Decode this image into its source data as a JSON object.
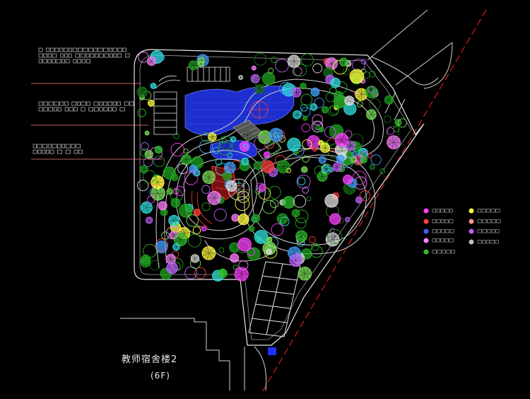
{
  "drawing": {
    "building_label": "教师宿舍楼2",
    "building_floors": "(6F)",
    "colors": {
      "background": "#000000",
      "boundary": "#e6e6e6",
      "property_line": "#ff2020",
      "tree_green": "#1fa21f",
      "tree_light": "#7ee35a",
      "water": "#1e2fcf",
      "path": "#cfcfcf",
      "pavilion": "#ff3b30",
      "leader": "#ff8080"
    },
    "legend": [
      {
        "color": "#ff40ff",
        "icon": "flower-shrub-icon"
      },
      {
        "color": "#ff4040",
        "icon": "red-flower-icon"
      },
      {
        "color": "#4060ff",
        "icon": "blue-flower-icon"
      },
      {
        "color": "#ff80ff",
        "icon": "pink-shrub-icon"
      },
      {
        "color": "#30c030",
        "icon": "green-tree-icon"
      },
      {
        "color": "#ffff40",
        "icon": "yellow-flower-icon"
      },
      {
        "color": "#ff9090",
        "icon": "light-shrub-icon"
      },
      {
        "color": "#c060ff",
        "icon": "purple-shrub-icon"
      },
      {
        "color": "#c0c0c0",
        "icon": "grey-shrub-icon"
      }
    ]
  }
}
